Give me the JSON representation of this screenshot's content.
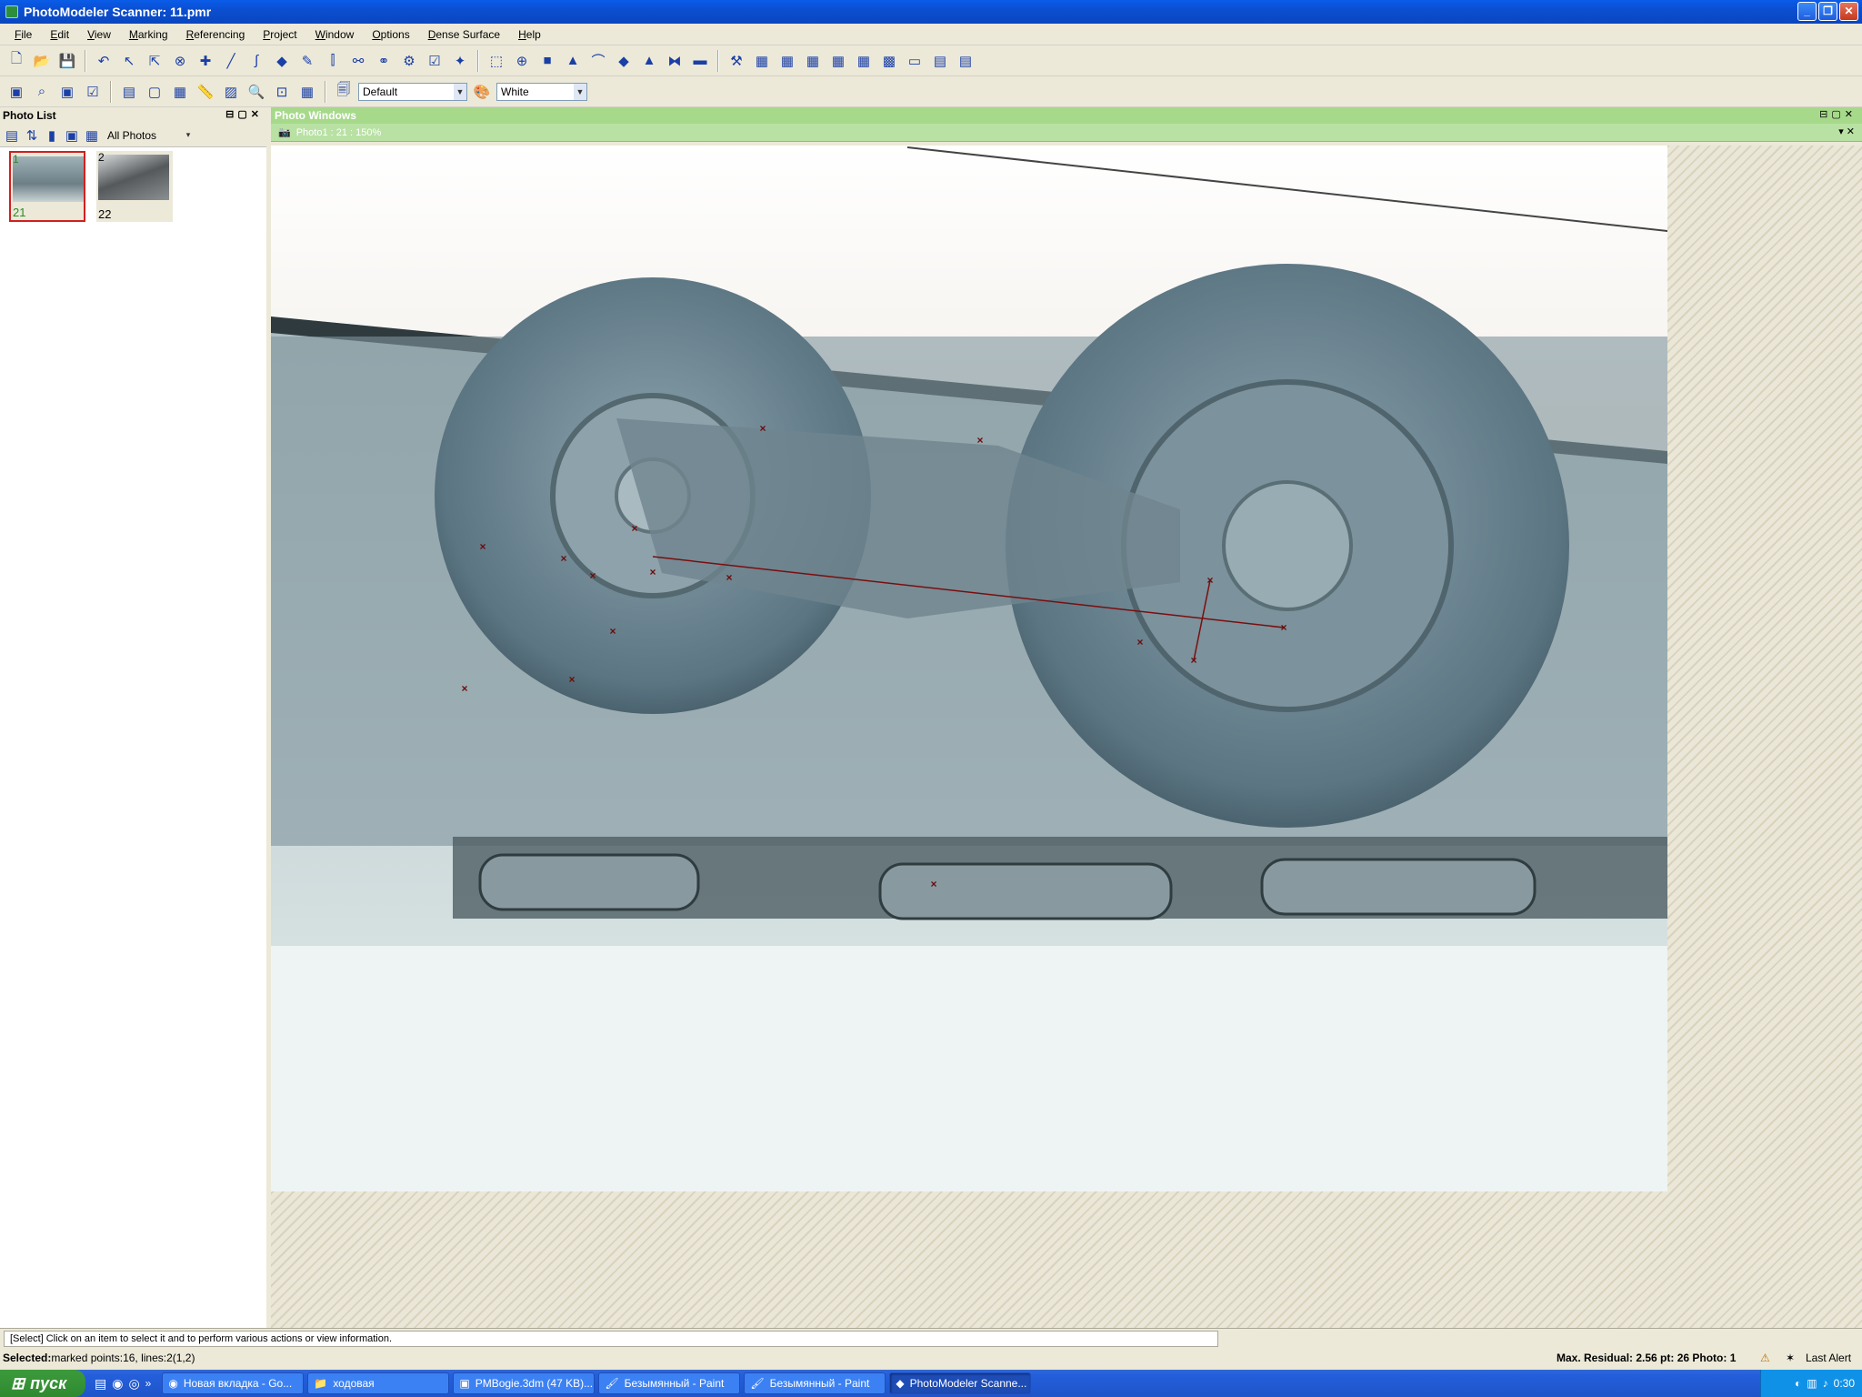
{
  "window": {
    "title": "PhotoModeler Scanner: 11.pmr",
    "minimize": "_",
    "restore": "❐",
    "close": "✕"
  },
  "menu": [
    "File",
    "Edit",
    "View",
    "Marking",
    "Referencing",
    "Project",
    "Window",
    "Options",
    "Dense Surface",
    "Help"
  ],
  "toolbar2": {
    "combo1_value": "Default",
    "combo2_value": "White"
  },
  "photo_list": {
    "title": "Photo List",
    "filter_value": "All Photos",
    "photos": [
      {
        "index": "1",
        "label": "21"
      },
      {
        "index": "2",
        "label": "22"
      }
    ]
  },
  "photo_windows": {
    "title": "Photo Windows",
    "tab_label": "Photo1 : 21 : 150%"
  },
  "status": {
    "message": "[Select] Click on an item to select it and to perform various actions or view information.",
    "selected_prefix": "Selected:",
    "selected_text": " marked points:16, lines:2(1,2)",
    "residual": "Max. Residual: 2.56 pt: 26 Photo: 1",
    "last_alert": "Last Alert"
  },
  "taskbar": {
    "start": "пуск",
    "tasks": [
      {
        "label": "Новая вкладка - Go...",
        "icon": "chrome-icon"
      },
      {
        "label": "ходовая",
        "icon": "folder-icon"
      },
      {
        "label": "PMBogie.3dm (47 KB)...",
        "icon": "rhino-icon"
      },
      {
        "label": "Безымянный - Paint",
        "icon": "paint-icon"
      },
      {
        "label": "Безымянный - Paint",
        "icon": "paint-icon"
      },
      {
        "label": "PhotoModeler Scanne...",
        "icon": "photomodeler-icon"
      }
    ],
    "clock": "0:30"
  }
}
